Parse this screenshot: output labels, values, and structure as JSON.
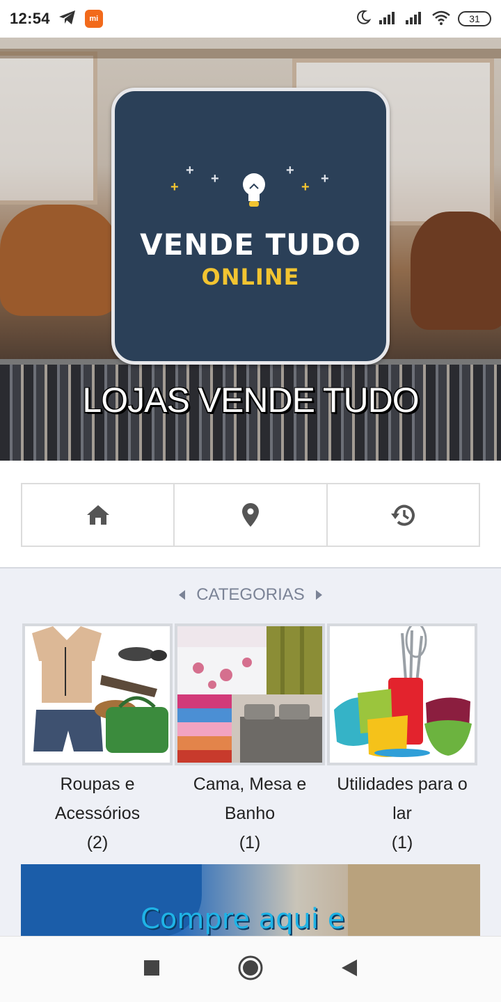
{
  "status_bar": {
    "time": "12:54",
    "battery": "31",
    "mi_badge": "mi"
  },
  "hero": {
    "logo_title": "VENDE TUDO",
    "logo_subtitle": "ONLINE",
    "store_name": "LOJAS VENDE TUDO"
  },
  "nav_buttons": [
    {
      "icon": "home-icon"
    },
    {
      "icon": "location-pin-icon"
    },
    {
      "icon": "history-icon"
    }
  ],
  "categories": {
    "title": "CATEGORIAS",
    "items": [
      {
        "label": "Roupas e Acessórios",
        "count": "(2)"
      },
      {
        "label": "Cama, Mesa e Banho",
        "count": "(1)"
      },
      {
        "label": "Utilidades para o lar",
        "count": "(1)"
      }
    ]
  },
  "banner": {
    "text": "Compre aqui e"
  },
  "colors": {
    "logo_bg": "#2b4058",
    "logo_accent": "#f2c431",
    "category_bg": "#eef0f6",
    "icon_gray": "#555555"
  }
}
